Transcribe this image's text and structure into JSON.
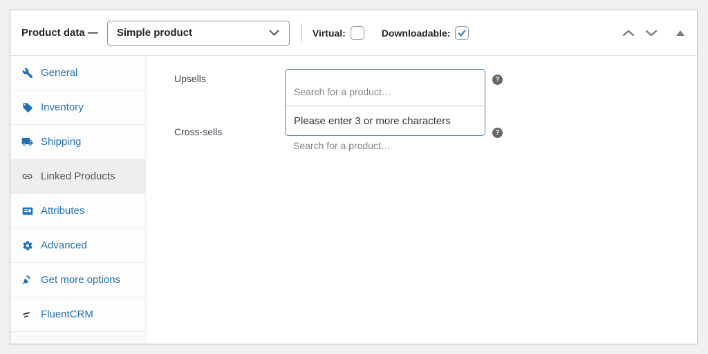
{
  "header": {
    "title": "Product data —",
    "product_type_select": {
      "value": "Simple product"
    },
    "virtual": {
      "label": "Virtual:",
      "checked": false
    },
    "downloadable": {
      "label": "Downloadable:",
      "checked": true
    }
  },
  "tabs": [
    {
      "label": "General",
      "icon": "wrench-icon",
      "active": false
    },
    {
      "label": "Inventory",
      "icon": "inventory-tag-icon",
      "active": false
    },
    {
      "label": "Shipping",
      "icon": "truck-icon",
      "active": false
    },
    {
      "label": "Linked Products",
      "icon": "link-icon",
      "active": true
    },
    {
      "label": "Attributes",
      "icon": "attributes-card-icon",
      "active": false
    },
    {
      "label": "Advanced",
      "icon": "gear-icon",
      "active": false
    },
    {
      "label": "Get more options",
      "icon": "plug-icon",
      "active": false
    },
    {
      "label": "FluentCRM",
      "icon": "fluentcrm-icon",
      "active": false
    }
  ],
  "panel": {
    "upsells": {
      "label": "Upsells",
      "placeholder": "Search for a product…",
      "dropdown_message": "Please enter 3 or more characters"
    },
    "cross_sells": {
      "label": "Cross-sells",
      "placeholder": "Search for a product…"
    },
    "help_icon": "?"
  },
  "colors": {
    "accent_blue": "#2271b1",
    "select2_border": "#4b80b5",
    "active_tab_bg": "#eeeeee",
    "check_blue": "#3582c4",
    "help_bg": "#666666"
  }
}
